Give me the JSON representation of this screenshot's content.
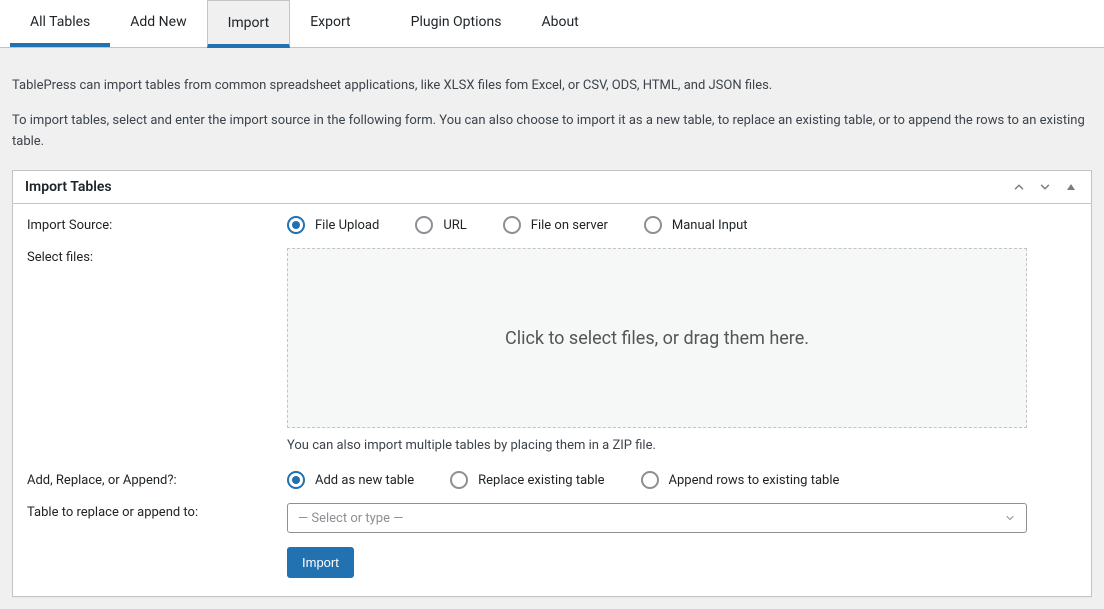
{
  "tabs": [
    {
      "label": "All Tables"
    },
    {
      "label": "Add New"
    },
    {
      "label": "Import"
    },
    {
      "label": "Export"
    },
    {
      "label": "Plugin Options"
    },
    {
      "label": "About"
    }
  ],
  "intro1": "TablePress can import tables from common spreadsheet applications, like XLSX files fom Excel, or CSV, ODS, HTML, and JSON files.",
  "intro2": "To import tables, select and enter the import source in the following form. You can also choose to import it as a new table, to replace an existing table, or to append the rows to an existing table.",
  "box": {
    "title": "Import Tables",
    "labels": {
      "source": "Import Source:",
      "select_files": "Select files:",
      "mode": "Add, Replace, or Append?:",
      "target": "Table to replace or append to:"
    },
    "source_options": [
      {
        "label": "File Upload",
        "selected": true
      },
      {
        "label": "URL",
        "selected": false
      },
      {
        "label": "File on server",
        "selected": false
      },
      {
        "label": "Manual Input",
        "selected": false
      }
    ],
    "dropzone_text": "Click to select files, or drag them here.",
    "zip_note": "You can also import multiple tables by placing them in a ZIP file.",
    "mode_options": [
      {
        "label": "Add as new table",
        "selected": true
      },
      {
        "label": "Replace existing table",
        "selected": false
      },
      {
        "label": "Append rows to existing table",
        "selected": false
      }
    ],
    "target_placeholder": "— Select or type —",
    "submit_label": "Import"
  }
}
